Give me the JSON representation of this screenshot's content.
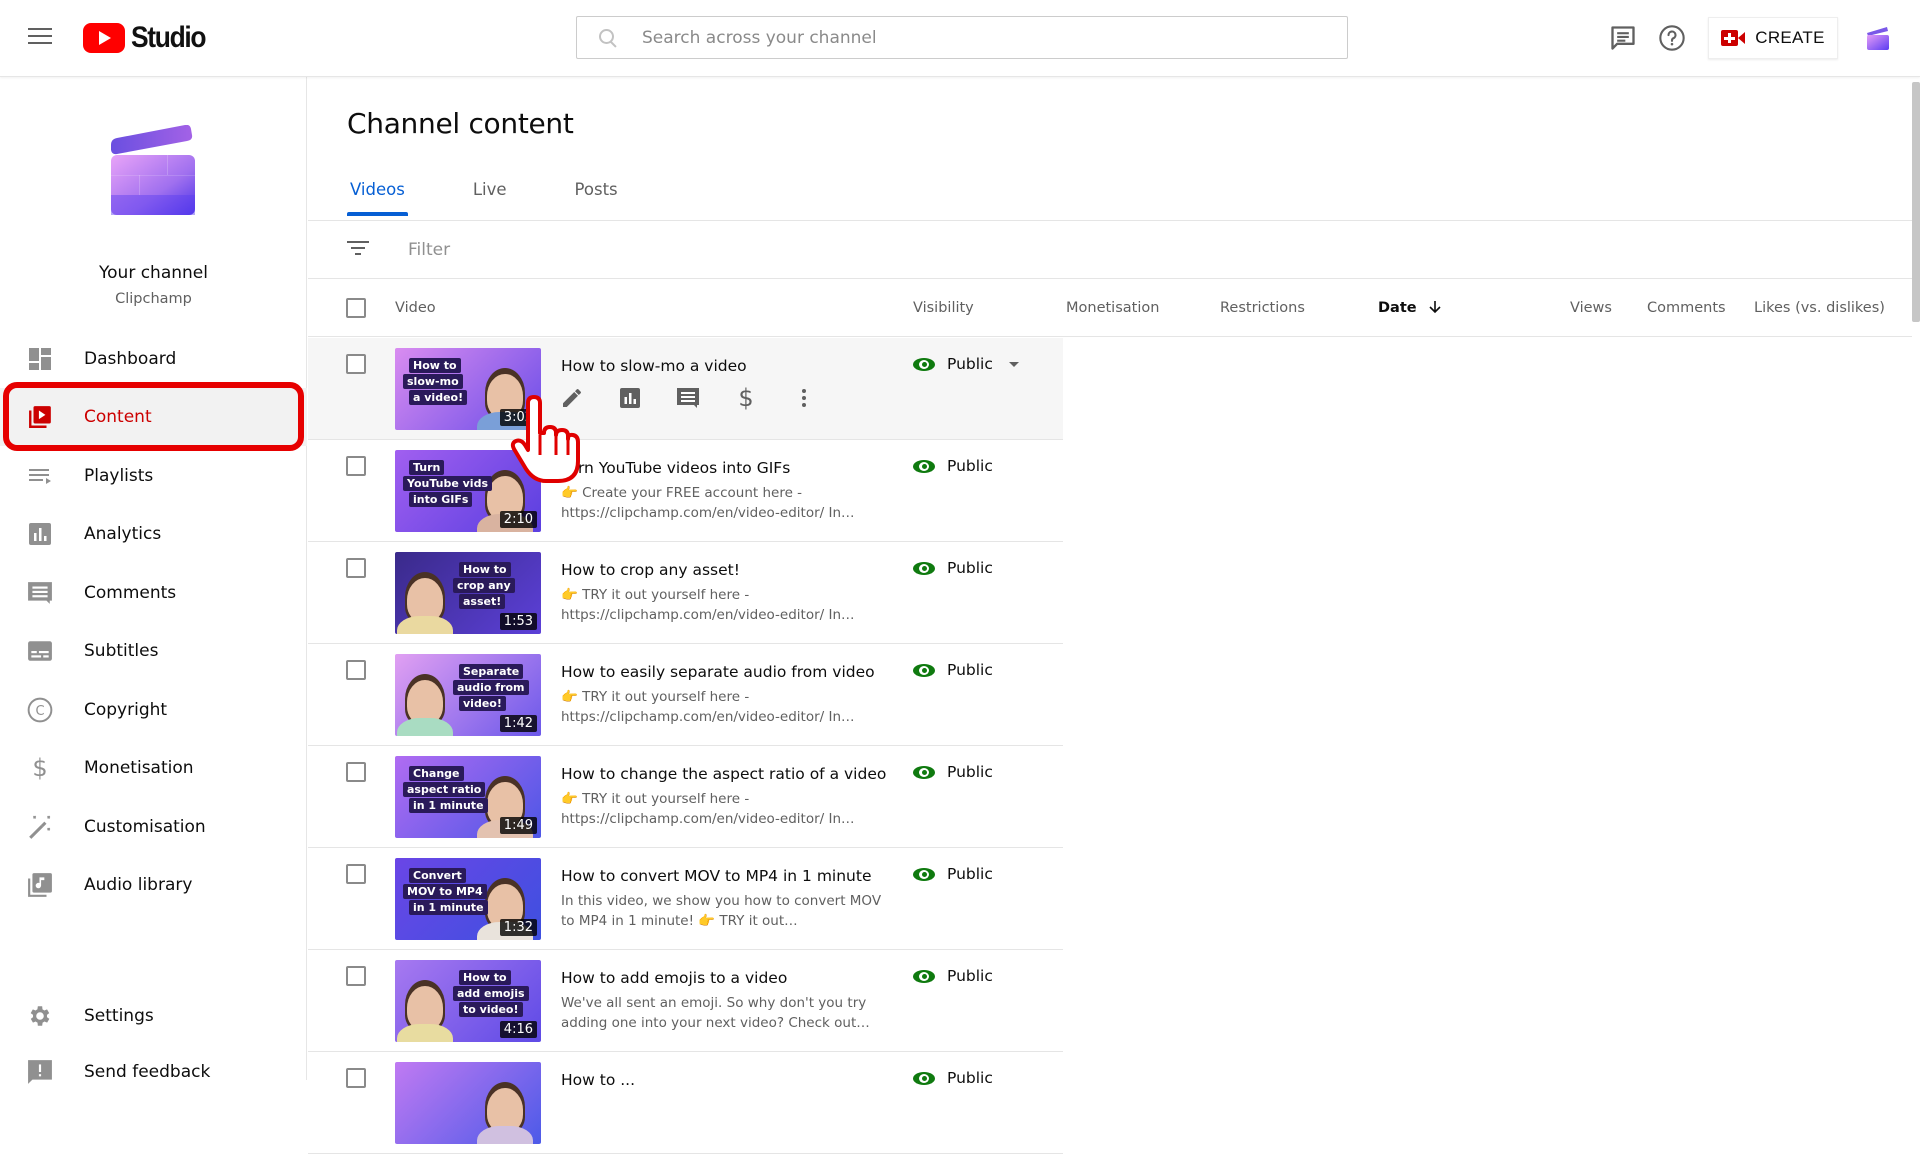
{
  "app": {
    "brand": "Studio",
    "search_placeholder": "Search across your channel",
    "create_label": "CREATE",
    "icons": {
      "menu": "hamburger-icon",
      "feedback": "message-icon",
      "help": "help-icon",
      "create": "video-camera-plus-icon",
      "account": "clipchamp-avatar"
    }
  },
  "channel": {
    "title": "Your channel",
    "name": "Clipchamp"
  },
  "sidebar": {
    "items": [
      {
        "label": "Dashboard",
        "icon": "dashboard-icon"
      },
      {
        "label": "Content",
        "icon": "content-icon",
        "active": true
      },
      {
        "label": "Playlists",
        "icon": "playlist-icon"
      },
      {
        "label": "Analytics",
        "icon": "analytics-icon"
      },
      {
        "label": "Comments",
        "icon": "comments-icon"
      },
      {
        "label": "Subtitles",
        "icon": "subtitles-icon"
      },
      {
        "label": "Copyright",
        "icon": "copyright-icon"
      },
      {
        "label": "Monetisation",
        "icon": "dollar-icon"
      },
      {
        "label": "Customisation",
        "icon": "magic-wand-icon"
      },
      {
        "label": "Audio library",
        "icon": "audio-library-icon"
      }
    ],
    "footer_items": [
      {
        "label": "Settings",
        "icon": "gear-icon"
      },
      {
        "label": "Send feedback",
        "icon": "feedback-icon"
      }
    ]
  },
  "main": {
    "title": "Channel content",
    "tabs": [
      {
        "label": "Videos",
        "active": true
      },
      {
        "label": "Live"
      },
      {
        "label": "Posts"
      }
    ],
    "filter_placeholder": "Filter",
    "columns": {
      "video": "Video",
      "visibility": "Visibility",
      "monetisation": "Monetisation",
      "restrictions": "Restrictions",
      "date": "Date",
      "views": "Views",
      "comments": "Comments",
      "likes": "Likes (vs. dislikes)"
    },
    "sort": {
      "column": "Date",
      "direction": "descending"
    },
    "row_actions": [
      "edit-icon",
      "analytics-icon",
      "comments-icon",
      "monetisation-icon",
      "more-options-icon"
    ],
    "videos": [
      {
        "title": "How to slow-mo a video",
        "description": "",
        "duration": "3:02",
        "visibility": "Public",
        "thumb_text": [
          "How to",
          "slow-mo",
          "a video!"
        ],
        "hovered": true
      },
      {
        "title": "Turn YouTube videos into GIFs",
        "description": "👉 Create your FREE account here - https://clipchamp.com/en/video-editor/ In…",
        "duration": "2:10",
        "visibility": "Public",
        "thumb_text": [
          "Turn",
          "YouTube vids",
          "into GIFs"
        ]
      },
      {
        "title": "How to crop any asset!",
        "description": "👉 TRY it out yourself here - https://clipchamp.com/en/video-editor/ In…",
        "duration": "1:53",
        "visibility": "Public",
        "thumb_text": [
          "How to",
          "crop any",
          "asset!"
        ]
      },
      {
        "title": "How to easily separate audio from video",
        "description": "👉 TRY it out yourself here - https://clipchamp.com/en/video-editor/ In…",
        "duration": "1:42",
        "visibility": "Public",
        "thumb_text": [
          "Separate",
          "audio from",
          "video!"
        ]
      },
      {
        "title": "How to change the aspect ratio of a video",
        "description": "👉 TRY it out yourself here - https://clipchamp.com/en/video-editor/ In…",
        "duration": "1:49",
        "visibility": "Public",
        "thumb_text": [
          "Change",
          "aspect ratio",
          "in 1 minute"
        ]
      },
      {
        "title": "How to convert MOV to MP4 in 1 minute",
        "description": "In this video, we show you how to convert MOV to MP4 in 1 minute! 👉 TRY it out…",
        "duration": "1:32",
        "visibility": "Public",
        "thumb_text": [
          "Convert",
          "MOV to MP4",
          "in 1 minute"
        ]
      },
      {
        "title": "How to add emojis to a video",
        "description": "We've all sent an emoji. So why don't you try adding one into your next video? Check out…",
        "duration": "4:16",
        "visibility": "Public",
        "thumb_text": [
          "How to",
          "add emojis",
          "to video!"
        ]
      },
      {
        "title": "How to ...",
        "description": "",
        "duration": "",
        "visibility": "Public",
        "thumb_text": [],
        "partial": true
      }
    ]
  }
}
